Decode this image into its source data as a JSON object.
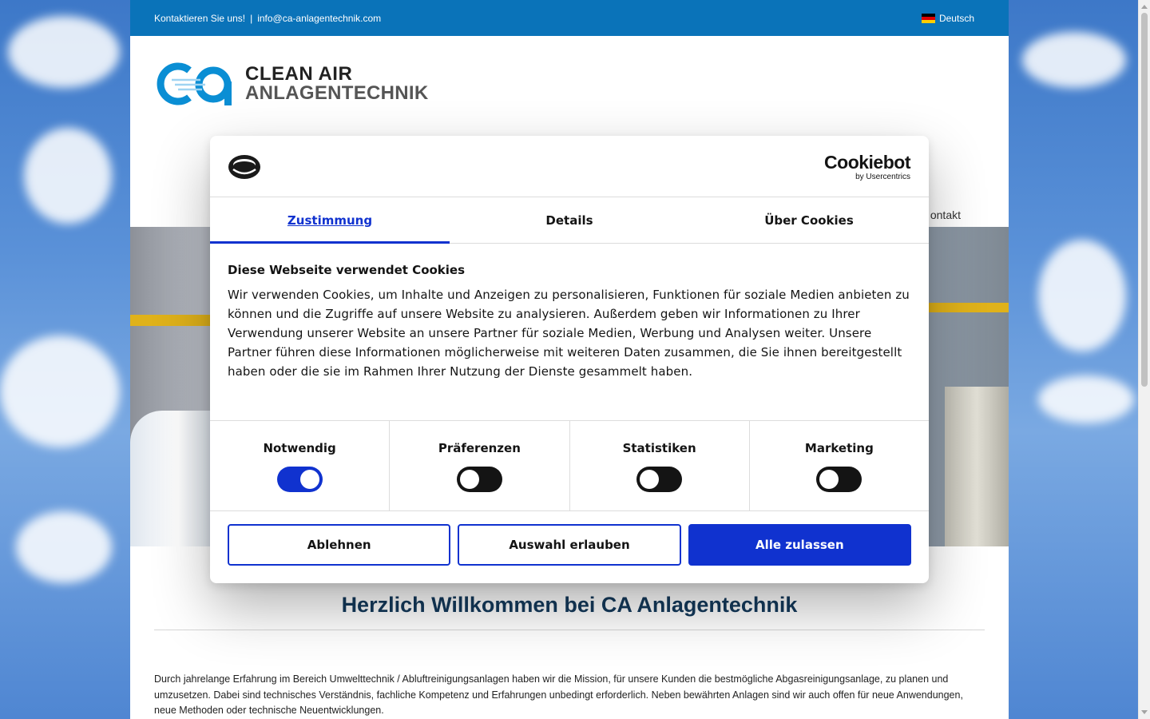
{
  "topbar": {
    "contact_label": "Kontaktieren Sie uns!",
    "separator": "|",
    "email": "info@ca-anlagentechnik.com",
    "language": "Deutsch"
  },
  "logo": {
    "line1": "CLEAN AIR",
    "line2": "ANLAGENTECHNIK"
  },
  "nav": {
    "kontakt": "ontakt"
  },
  "main": {
    "welcome": "Herzlich Willkommen bei CA Anlagentechnik",
    "intro": "Durch jahrelange Erfahrung im Bereich Umwelttechnik / Abluftreinigungsanlagen haben wir die Mission, für unsere Kunden die bestmögliche Abgasreinigungsanlage, zu planen und umzusetzen. Dabei sind technisches Verständnis, fachliche Kompetenz und Erfahrungen unbedingt erforderlich. Neben bewährten Anlagen sind wir auch offen für neue Anwendungen, neue Methoden oder technische Neuentwicklungen."
  },
  "cookie_dialog": {
    "powered_by": "Cookiebot",
    "powered_by_sub": "by Usercentrics",
    "tabs": [
      "Zustimmung",
      "Details",
      "Über Cookies"
    ],
    "active_tab": "Zustimmung",
    "heading": "Diese Webseite verwendet Cookies",
    "text": "Wir verwenden Cookies, um Inhalte und Anzeigen zu personalisieren, Funktionen für soziale Medien anbieten zu können und die Zugriffe auf unsere Website zu analysieren. Außerdem geben wir Informationen zu Ihrer Verwendung unserer Website an unsere Partner für soziale Medien, Werbung und Analysen weiter. Unsere Partner führen diese Informationen möglicherweise mit weiteren Daten zusammen, die Sie ihnen bereitgestellt haben oder die sie im Rahmen Ihrer Nutzung der Dienste gesammelt haben.",
    "consents": [
      {
        "label": "Notwendig",
        "checked": true
      },
      {
        "label": "Präferenzen",
        "checked": false
      },
      {
        "label": "Statistiken",
        "checked": false
      },
      {
        "label": "Marketing",
        "checked": false
      }
    ],
    "buttons": {
      "decline": "Ablehnen",
      "allow_selection": "Auswahl erlauben",
      "allow_all": "Alle zulassen"
    }
  },
  "colors": {
    "accent": "#1032cf",
    "topbar": "#0a73b9",
    "heading": "#143a5c"
  }
}
